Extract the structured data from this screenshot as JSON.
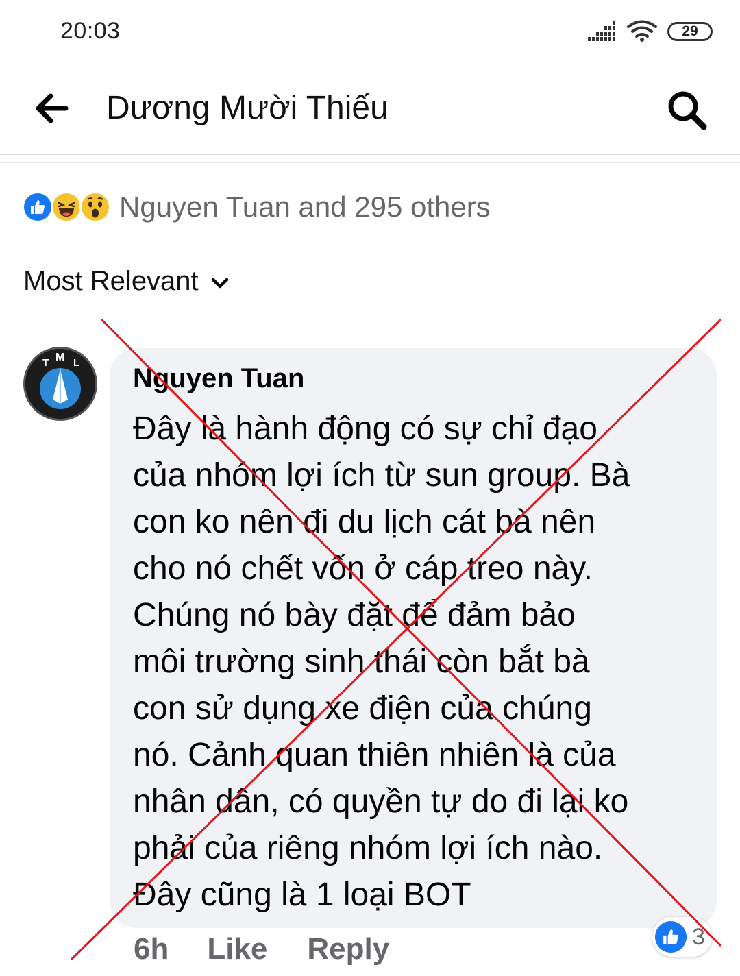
{
  "status_bar": {
    "time": "20:03",
    "battery": "29",
    "icons": [
      "signal-icon",
      "wifi-icon",
      "battery-icon"
    ]
  },
  "header": {
    "back_icon": "arrow-left-icon",
    "title": "Dương Mười Thiếu",
    "search_icon": "search-icon"
  },
  "reactions": {
    "icons": [
      "like-icon",
      "haha-icon",
      "wow-icon"
    ],
    "summary": "Nguyen Tuan and 295 others"
  },
  "sort": {
    "label": "Most Relevant",
    "icon": "chevron-down-icon"
  },
  "comment": {
    "avatar_letters": [
      "T",
      "M",
      "L"
    ],
    "author": "Nguyen Tuan",
    "lines": [
      "Đây là hành động có sự chỉ đạo",
      "của nhóm lợi ích từ sun group. Bà",
      "con ko nên đi du lịch cát bà nên",
      "cho nó chết vốn ở cáp treo này.",
      "Chúng nó bày đặt để đảm bảo",
      "môi trường sinh thái còn bắt bà",
      "con sử dụng xe điện của chúng",
      "nó. Cảnh quan thiên nhiên là của",
      "nhân dân, có quyền tự do đi lại ko",
      "phải của riêng nhóm lợi ích nào.",
      "Đây cũng là 1 loại BOT"
    ],
    "time": "6h",
    "like_label": "Like",
    "reply_label": "Reply",
    "reaction_count": "3"
  },
  "colors": {
    "accent": "#1877f2",
    "bubble": "#f0f2f5",
    "muted_text": "#65676b",
    "cross": "#e3161b"
  }
}
